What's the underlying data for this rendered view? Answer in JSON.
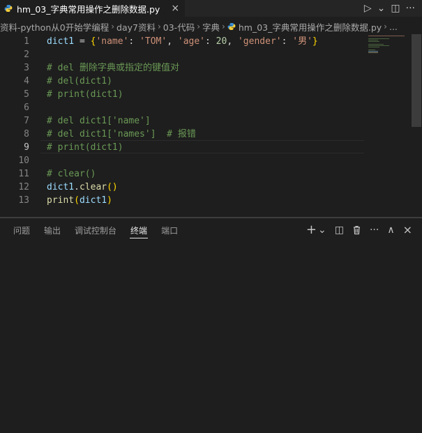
{
  "tab": {
    "filename": "hm_03_字典常用操作之删除数据.py",
    "close_glyph": "×"
  },
  "tab_actions": {
    "run": "▷",
    "run_menu": "⌄",
    "split": "◫",
    "more": "···"
  },
  "breadcrumb": {
    "items": [
      "资料-python从0开始学编程",
      "day7资料",
      "03-代码",
      "字典",
      "hm_03_字典常用操作之删除数据.py",
      "..."
    ],
    "separator": "›"
  },
  "editor": {
    "active_line": 9,
    "lines": [
      {
        "n": "1"
      },
      {
        "n": "2"
      },
      {
        "n": "3"
      },
      {
        "n": "4"
      },
      {
        "n": "5"
      },
      {
        "n": "6"
      },
      {
        "n": "7"
      },
      {
        "n": "8"
      },
      {
        "n": "9"
      },
      {
        "n": "10"
      },
      {
        "n": "11"
      },
      {
        "n": "12"
      },
      {
        "n": "13"
      }
    ],
    "tokens": {
      "l1": [
        "dict1",
        " = ",
        "{",
        "'name'",
        ": ",
        "'TOM'",
        ", ",
        "'age'",
        ": ",
        "20",
        ", ",
        "'gender'",
        ": ",
        "'男'",
        "}"
      ],
      "l3": "# del 删除字典或指定的键值对",
      "l4": "# del(dict1)",
      "l5": "# print(dict1)",
      "l7": "# del dict1['name']",
      "l8": "# del dict1['names']  # 报错",
      "l9": "# print(dict1)",
      "l11": "# clear()",
      "l12": [
        "dict1",
        ".",
        "clear",
        "()"
      ],
      "l13": [
        "print",
        "(",
        "dict1",
        ")"
      ]
    }
  },
  "panel": {
    "tabs": [
      "问题",
      "输出",
      "调试控制台",
      "终端",
      "端口"
    ],
    "active_tab": "终端",
    "actions": {
      "new_terminal": "+",
      "new_terminal_menu": "⌄",
      "split": "◫",
      "kill": "🗑",
      "more": "···",
      "maximize": "∧",
      "close": "×"
    }
  },
  "colors": {
    "background": "#1e1e1e",
    "comment": "#6a9955",
    "string": "#ce9178",
    "variable": "#9cdcfe",
    "function": "#dcdcaa",
    "number": "#b5cea8",
    "bracket": "#ffd700",
    "python_icon": "#3b8fd6"
  }
}
